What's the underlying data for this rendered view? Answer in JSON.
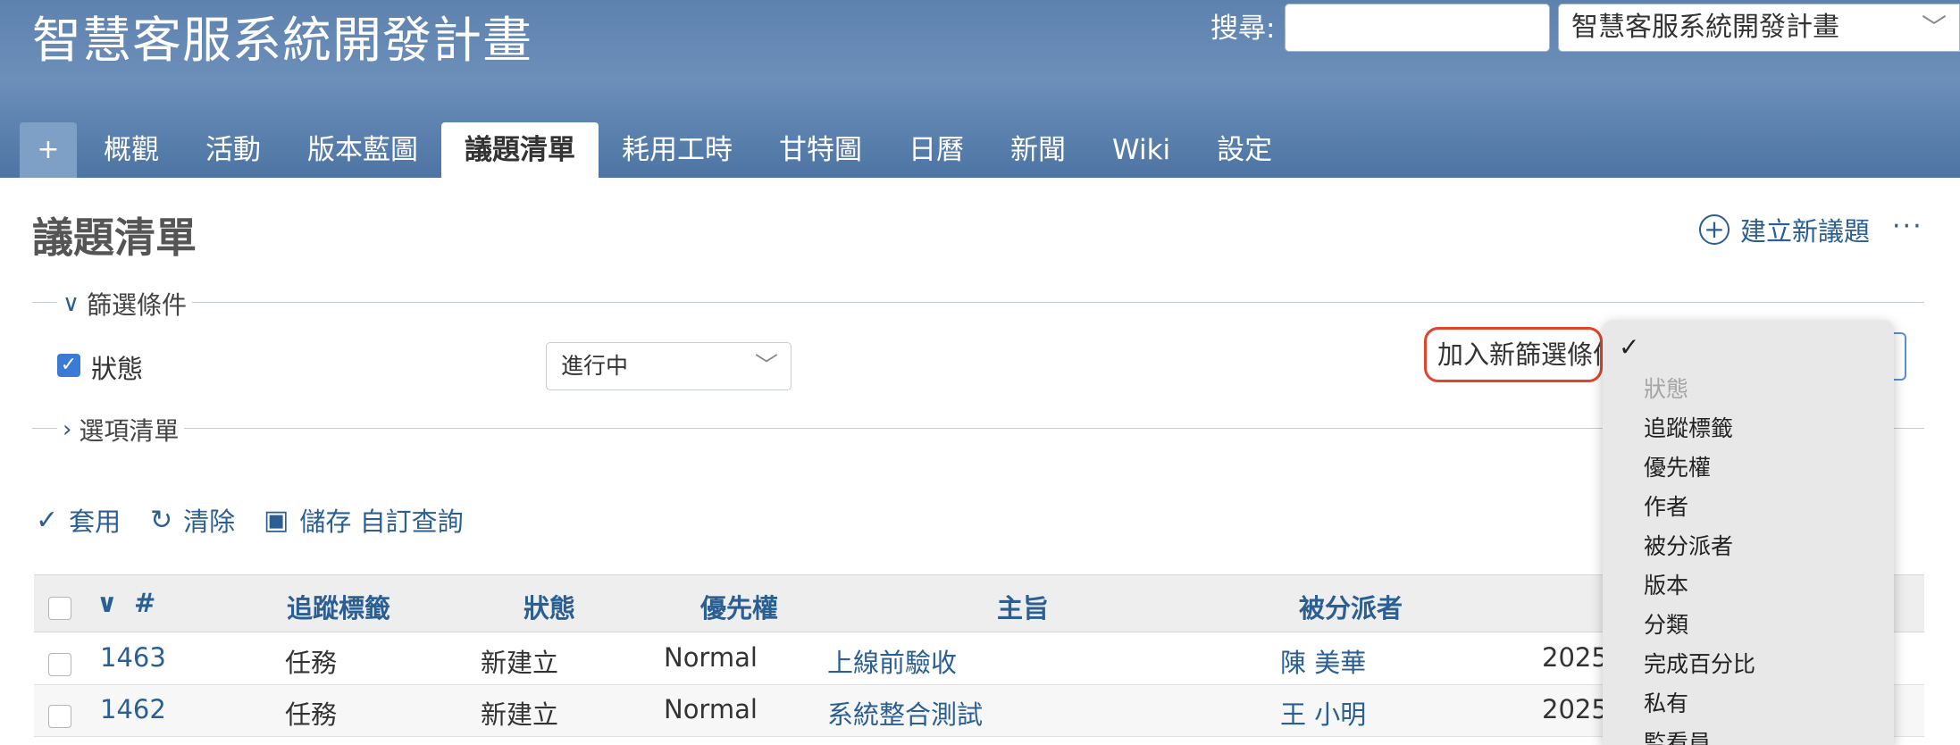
{
  "header": {
    "project_title": "智慧客服系統開發計畫",
    "search_label": "搜尋:",
    "search_value": "",
    "project_jump_value": "智慧客服系統開發計畫"
  },
  "tabs": [
    {
      "label": "+"
    },
    {
      "label": "概觀"
    },
    {
      "label": "活動"
    },
    {
      "label": "版本藍圖"
    },
    {
      "label": "議題清單",
      "selected": true
    },
    {
      "label": "耗用工時"
    },
    {
      "label": "甘特圖"
    },
    {
      "label": "日曆"
    },
    {
      "label": "新聞"
    },
    {
      "label": "Wiki"
    },
    {
      "label": "設定"
    }
  ],
  "page": {
    "title": "議題清單",
    "new_issue_label": "建立新議題",
    "more_label": "···"
  },
  "filters": {
    "legend": "篩選條件",
    "status_label": "狀態",
    "status_checked": true,
    "status_value": "進行中",
    "add_filter_label": "加入新篩選條件"
  },
  "options": {
    "legend": "選項清單"
  },
  "actions": {
    "apply": "套用",
    "clear": "清除",
    "save": "儲存 自訂查詢"
  },
  "table": {
    "columns": [
      "#",
      "追蹤標籤",
      "狀態",
      "優先權",
      "主旨",
      "被分派者"
    ],
    "rows": [
      {
        "id": "1463",
        "tracker": "任務",
        "status": "新建立",
        "priority": "Normal",
        "subject": "上線前驗收",
        "assignee": "陳 美華",
        "date": "2025"
      },
      {
        "id": "1462",
        "tracker": "任務",
        "status": "新建立",
        "priority": "Normal",
        "subject": "系統整合測試",
        "assignee": "王 小明",
        "date": "2025"
      }
    ]
  },
  "dropdown": {
    "checked_marker": "✓",
    "items": [
      {
        "label": "狀態",
        "disabled": true
      },
      {
        "label": "追蹤標籤"
      },
      {
        "label": "優先權"
      },
      {
        "label": "作者"
      },
      {
        "label": "被分派者"
      },
      {
        "label": "版本"
      },
      {
        "label": "分類"
      },
      {
        "label": "完成百分比"
      },
      {
        "label": "私有"
      },
      {
        "label": "監看員"
      }
    ]
  },
  "colors": {
    "header_blue": "#5e82ae",
    "link_blue": "#2b5f93",
    "highlight_red": "#e0452b",
    "checkbox_blue": "#3a7bd5"
  }
}
